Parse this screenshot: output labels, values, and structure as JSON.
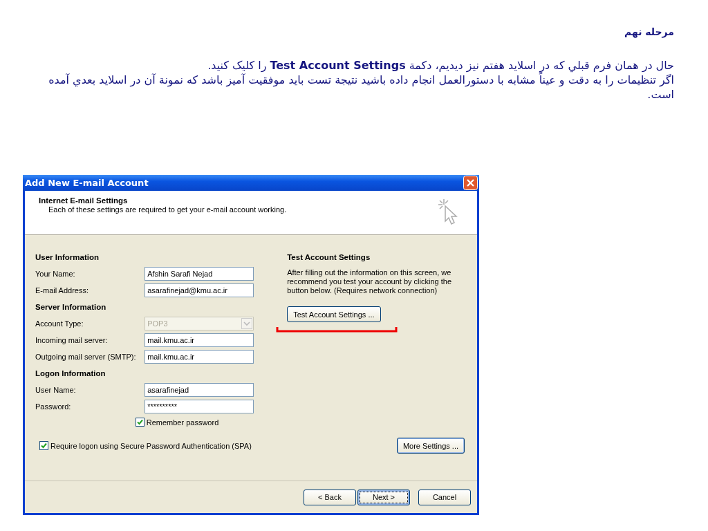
{
  "heading": "مرحله نهم",
  "paragraphs": [
    "حال در همان فرم قبلي که در اسلايد هفتم نيز ديديم، دکمة **Test Account Settings** را کليک کنيد.",
    "اگر تنظيمات را به دقت و عيناً مشابه با دستورالعمل انجام داده باشيد نتيجة تست بايد موفقيت آميز باشد که نمونة آن در اسلايد بعدي آمده است."
  ],
  "dialog": {
    "title": "Add New E-mail Account",
    "header": {
      "title": "Internet E-mail Settings",
      "subtitle": "Each of these settings are required to get your e-mail account working."
    },
    "sections": [
      {
        "title": "User Information",
        "fields": [
          {
            "label": "Your Name:",
            "value": "Afshin Sarafi Nejad",
            "kind": "text",
            "disabled": false
          },
          {
            "label": "E-mail Address:",
            "value": "asarafinejad@kmu.ac.ir",
            "kind": "text",
            "disabled": false
          }
        ]
      },
      {
        "title": "Server Information",
        "fields": [
          {
            "label": "Account Type:",
            "value": "POP3",
            "kind": "select",
            "disabled": true
          },
          {
            "label": "Incoming mail server:",
            "value": "mail.kmu.ac.ir",
            "kind": "text",
            "disabled": false
          },
          {
            "label": "Outgoing mail server (SMTP):",
            "value": "mail.kmu.ac.ir",
            "kind": "text",
            "disabled": false
          }
        ]
      },
      {
        "title": "Logon Information",
        "fields": [
          {
            "label": "User Name:",
            "value": "asarafinejad",
            "kind": "text",
            "disabled": false
          },
          {
            "label": "Password:",
            "value": "**********",
            "kind": "password",
            "disabled": false
          }
        ]
      }
    ],
    "remember_password": {
      "label": "Remember password",
      "checked": true
    },
    "spa": {
      "label": "Require logon using Secure Password Authentication (SPA)",
      "checked": true
    },
    "test": {
      "title": "Test Account Settings",
      "description": "After filling out the information on this screen, we recommend you test your account by clicking the button below. (Requires network connection)",
      "button": "Test Account Settings ..."
    },
    "more_button": "More Settings ...",
    "buttons": [
      {
        "label": "< Back",
        "default": false
      },
      {
        "label": "Next >",
        "default": true
      },
      {
        "label": "Cancel",
        "default": false
      }
    ]
  }
}
